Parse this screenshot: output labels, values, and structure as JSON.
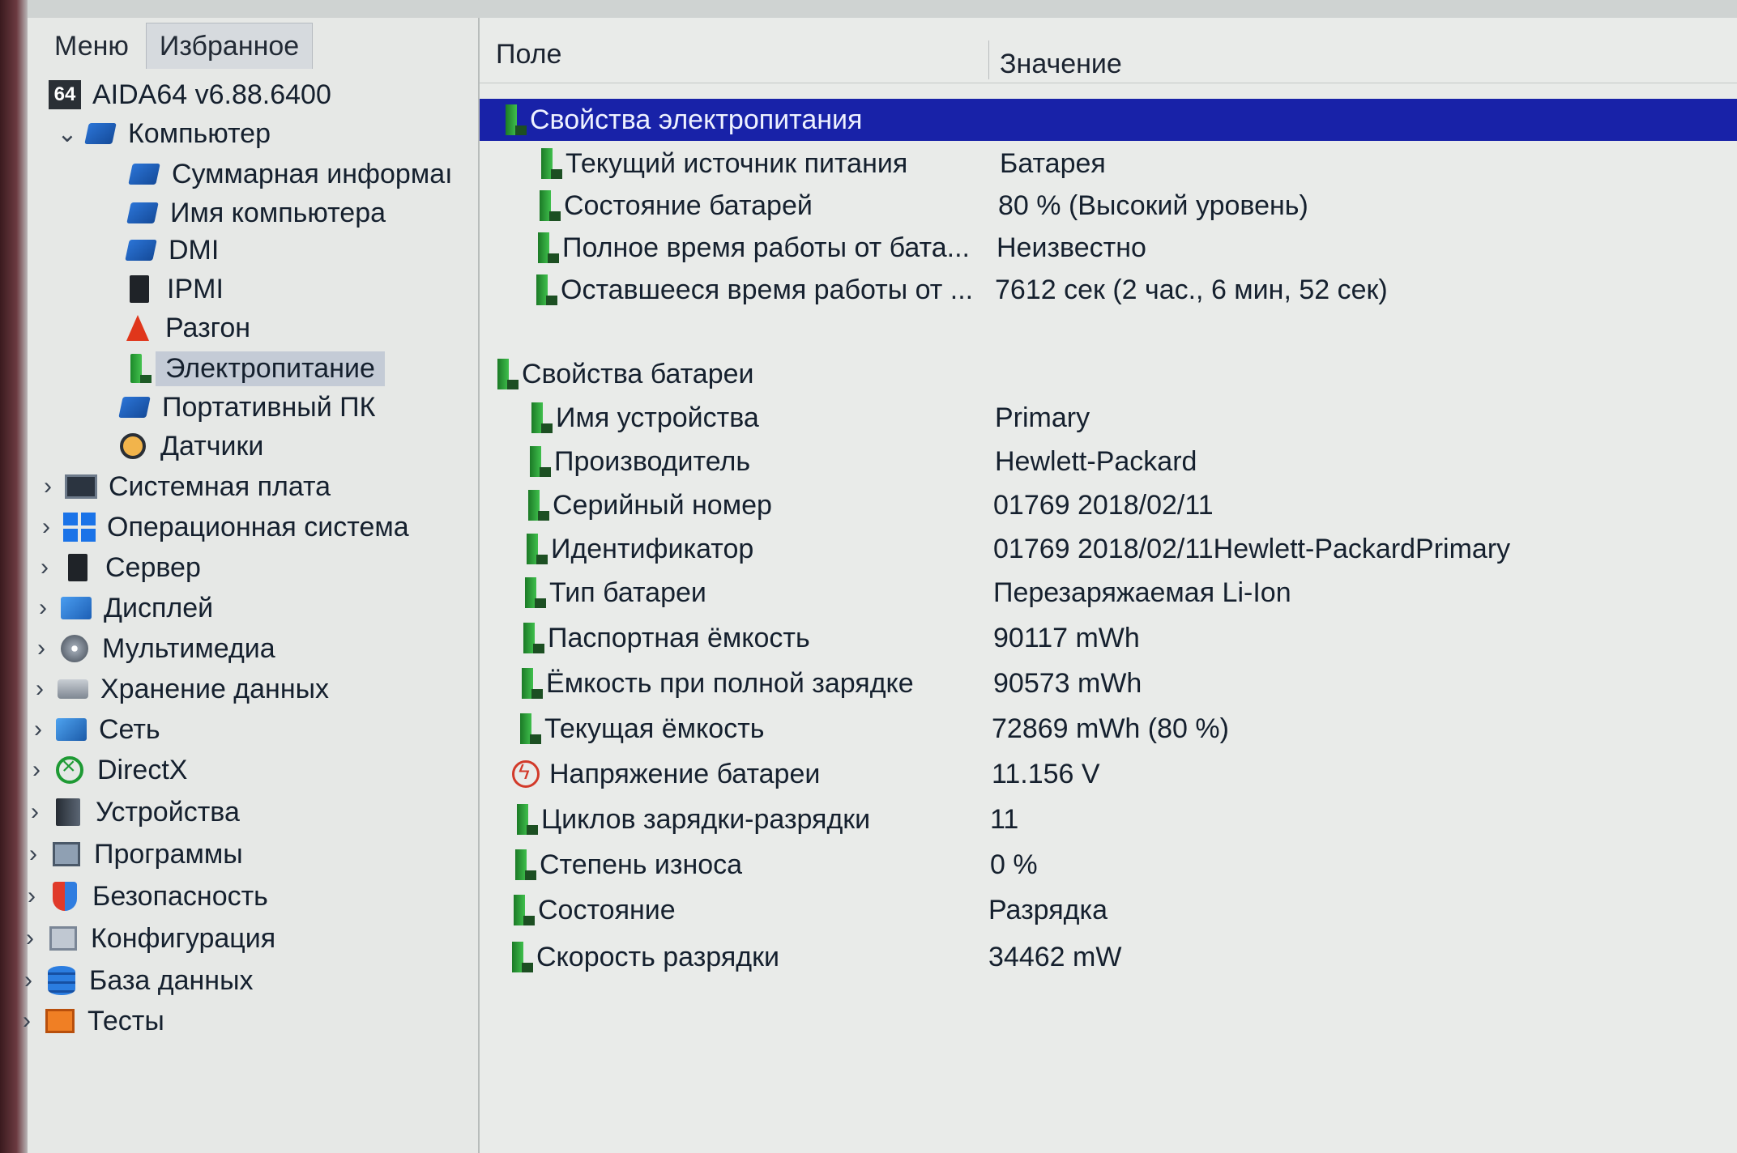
{
  "tabs": {
    "menu": "Меню",
    "favorites": "Избранное"
  },
  "tree": {
    "root": "AIDA64 v6.88.6400",
    "root_badge": "64",
    "computer": "Компьютер",
    "computer_children": [
      "Суммарная информаı",
      "Имя компьютера",
      "DMI",
      "IPMI",
      "Разгон",
      "Электропитание",
      "Портативный ПК",
      "Датчики"
    ],
    "sections": [
      "Системная плата",
      "Операционная система",
      "Сервер",
      "Дисплей",
      "Мультимедиа",
      "Хранение данных",
      "Сеть",
      "DirectX",
      "Устройства",
      "Программы",
      "Безопасность",
      "Конфигурация",
      "База данных",
      "Тесты"
    ]
  },
  "columns": {
    "field": "Поле",
    "value": "Значение"
  },
  "power_group": {
    "title": "Свойства электропитания",
    "rows": [
      {
        "field": "Текущий источник питания",
        "value": "Батарея"
      },
      {
        "field": "Состояние батарей",
        "value": "80 % (Высокий уровень)"
      },
      {
        "field": "Полное время работы от бата...",
        "value": "Неизвестно"
      },
      {
        "field": "Оставшееся время работы от ...",
        "value": "7612 сек (2 час., 6 мин, 52 сек)"
      }
    ]
  },
  "battery_group": {
    "title": "Свойства батареи",
    "rows": [
      {
        "field": "Имя устройства",
        "value": "Primary"
      },
      {
        "field": "Производитель",
        "value": "Hewlett-Packard"
      },
      {
        "field": "Серийный номер",
        "value": "01769 2018/02/11"
      },
      {
        "field": "Идентификатор",
        "value": "01769 2018/02/11Hewlett-PackardPrimary"
      },
      {
        "field": "Тип батареи",
        "value": "Перезаряжаемая Li-Ion"
      },
      {
        "field": "Паспортная ёмкость",
        "value": "90117 mWh"
      },
      {
        "field": "Ёмкость при полной зарядке",
        "value": "90573 mWh"
      },
      {
        "field": "Текущая ёмкость",
        "value": "72869 mWh  (80 %)"
      },
      {
        "field": "Напряжение батареи",
        "value": "11.156 V"
      },
      {
        "field": "Циклов зарядки-разрядки",
        "value": "11"
      },
      {
        "field": "Степень износа",
        "value": "0 %"
      },
      {
        "field": "Состояние",
        "value": "Разрядка"
      },
      {
        "field": "Скорость разрядки",
        "value": "34462 mW"
      }
    ]
  },
  "colors": {
    "selection": "#1822a8",
    "tree_selection": "#c4cbd6",
    "battery_green": "#3fbf4c"
  }
}
